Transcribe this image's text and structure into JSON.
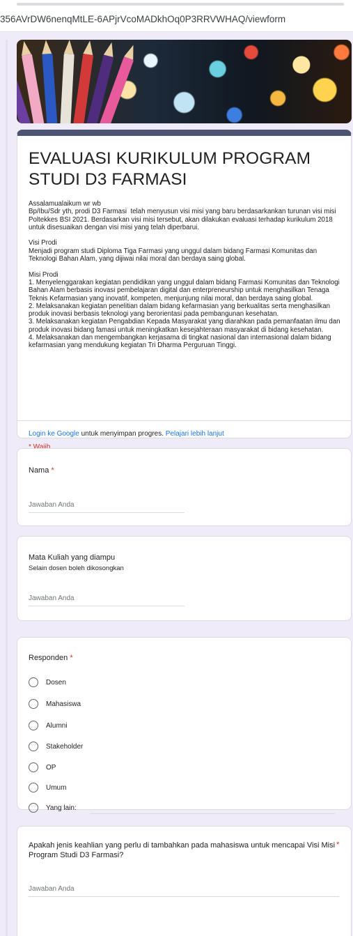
{
  "browser": {
    "url": "356AVrDW6nenqMtLE-6APjrVcoMADkhOq0P3RRVWHAQ/viewform"
  },
  "form": {
    "title": "EVALUASI KURIKULUM PROGRAM STUDI D3 FARMASI",
    "description": "Assalamualaikum wr wb\nBp/Ibu/Sdr yth, prodi D3 Farmasi  telah menyusun visi misi yang baru berdasarkankan turunan visi misi Poltekkes BSI 2021. Berdasarkan visi misi tersebut, akan dilakukan evaluasi terhadap kurikulum 2018 untuk disesuaikan dengan visi misi yang telah diperbarui.\n\nVisi Prodi\nMenjadi program studi Diploma Tiga Farmasi yang unggul dalam bidang Farmasi Komunitas dan Teknologi Bahan Alam, yang dijiwai nilai moral dan berdaya saing global.\n\nMisi Prodi\n1. Menyelenggarakan kegiatan pendidikan yang unggul dalam bidang Farmasi Komunitas dan Teknologi Bahan Alam berbasis inovasi pembelajaran digital dan enterpreneurship untuk menghasilkan Tenaga Teknis Kefarmasian yang inovatif, kompeten, menjunjung nilai moral, dan berdaya saing global.\n2. Melaksanakan kegiatan penelitian dalam bidang kefarmasian yang berkualitas serta menghasilkan produk inovasi berbasis teknologi yang berorientasi pada pembangunan kesehatan.\n3. Melaksanakan kegiatan Pengabdian Kepada Masyarakat yang diarahkan pada pemanfaatan ilmu dan produk inovasi bidang famasi untuk meningkatkan kesejahteraan masyarakat di bidang kesehatan.\n4. Melaksanakan dan mengembangkan kerjasama di tingkat nasional dan internasional dalam bidang kefarmasian yang mendukung kegiatan Tri Dharma Perguruan Tinggi.",
    "login_link": "Login ke Google",
    "login_text": " untuk menyimpan progres. ",
    "learn_more": "Pelajari lebih lanjut",
    "required_note": "* Wajib"
  },
  "questions": {
    "nama": {
      "label": "Nama",
      "required_mark": "*",
      "placeholder": "Jawaban Anda"
    },
    "mata_kuliah": {
      "label": "Mata Kuliah yang diampu",
      "helper": "Selain dosen boleh dikosongkan",
      "placeholder": "Jawaban Anda"
    },
    "responden": {
      "label": "Responden",
      "required_mark": "*",
      "options": [
        "Dosen",
        "Mahasiswa",
        "Alumni",
        "Stakeholder",
        "OP",
        "Umum",
        "Yang lain:"
      ]
    },
    "keahlian": {
      "label": "Apakah jenis keahlian yang perlu di tambahkan pada mahasiswa untuk mencapai Visi Misi Program Studi D3 Farmasi?",
      "required_mark": "*",
      "placeholder": "Jawaban Anda"
    }
  },
  "colors": {
    "accent": "#4c5474",
    "background": "#f0ebf8",
    "required": "#d93025",
    "link": "#1a73e8"
  },
  "icons": {
    "radio": "radio-button-unchecked-icon"
  }
}
